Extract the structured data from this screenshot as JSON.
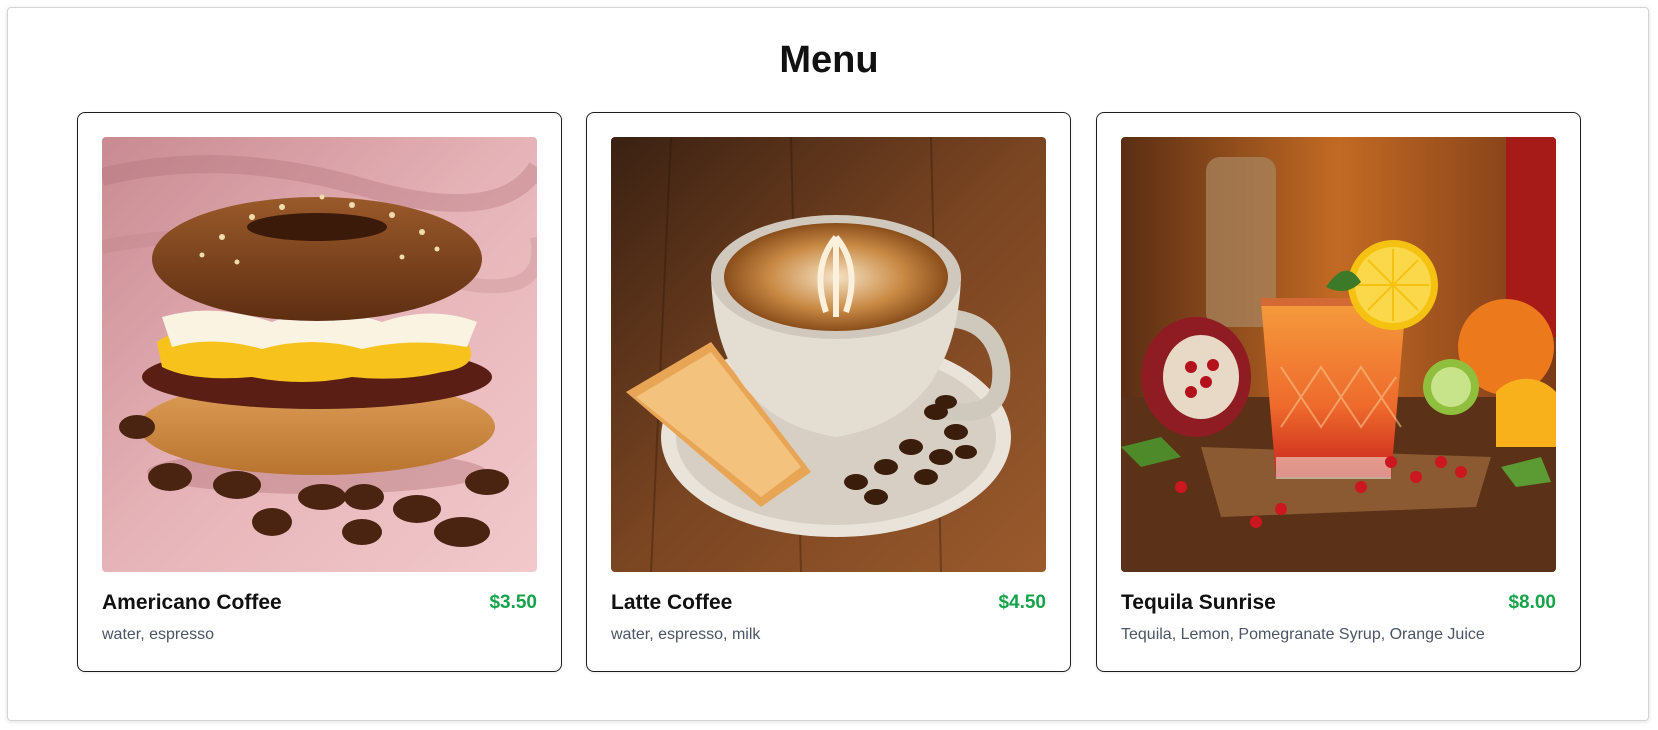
{
  "page": {
    "title": "Menu"
  },
  "theme": {
    "price_color": "#16a34a",
    "text_color": "#111111",
    "desc_color": "#4b5563",
    "card_border": "#1f1f1f"
  },
  "menu": {
    "items": [
      {
        "name": "Americano Coffee",
        "price": "$3.50",
        "description": "water, espresso",
        "image_icon": "bagel-sandwich-photo"
      },
      {
        "name": "Latte Coffee",
        "price": "$4.50",
        "description": "water, espresso, milk",
        "image_icon": "latte-cup-photo"
      },
      {
        "name": "Tequila Sunrise",
        "price": "$8.00",
        "description": "Tequila, Lemon, Pomegranate Syrup, Orange Juice",
        "image_icon": "cocktail-glass-photo"
      }
    ]
  }
}
